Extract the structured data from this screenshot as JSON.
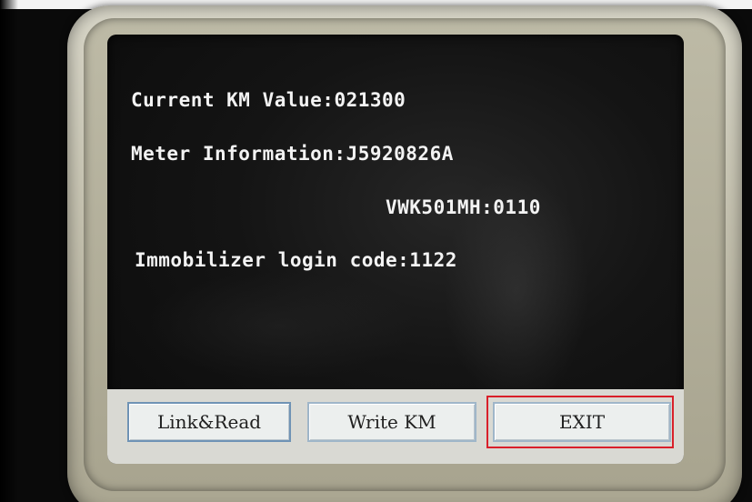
{
  "display": {
    "lines": [
      {
        "label": "Current KM Value:",
        "value": "021300"
      },
      {
        "label": "Meter Information:",
        "value": "J5920826A"
      },
      {
        "label": "",
        "value": "VWK501MH:0110"
      },
      {
        "label": "Immobilizer login code:",
        "value": "1122"
      }
    ]
  },
  "buttons": {
    "link_read": "Link&Read",
    "write_km": "Write KM",
    "exit": "EXIT"
  },
  "colors": {
    "screen_background": "#141414",
    "text": "#f3f3f3",
    "button_bar": "#d9d9d3",
    "button_face": "#ecefee",
    "highlight_box": "#d9202a"
  }
}
